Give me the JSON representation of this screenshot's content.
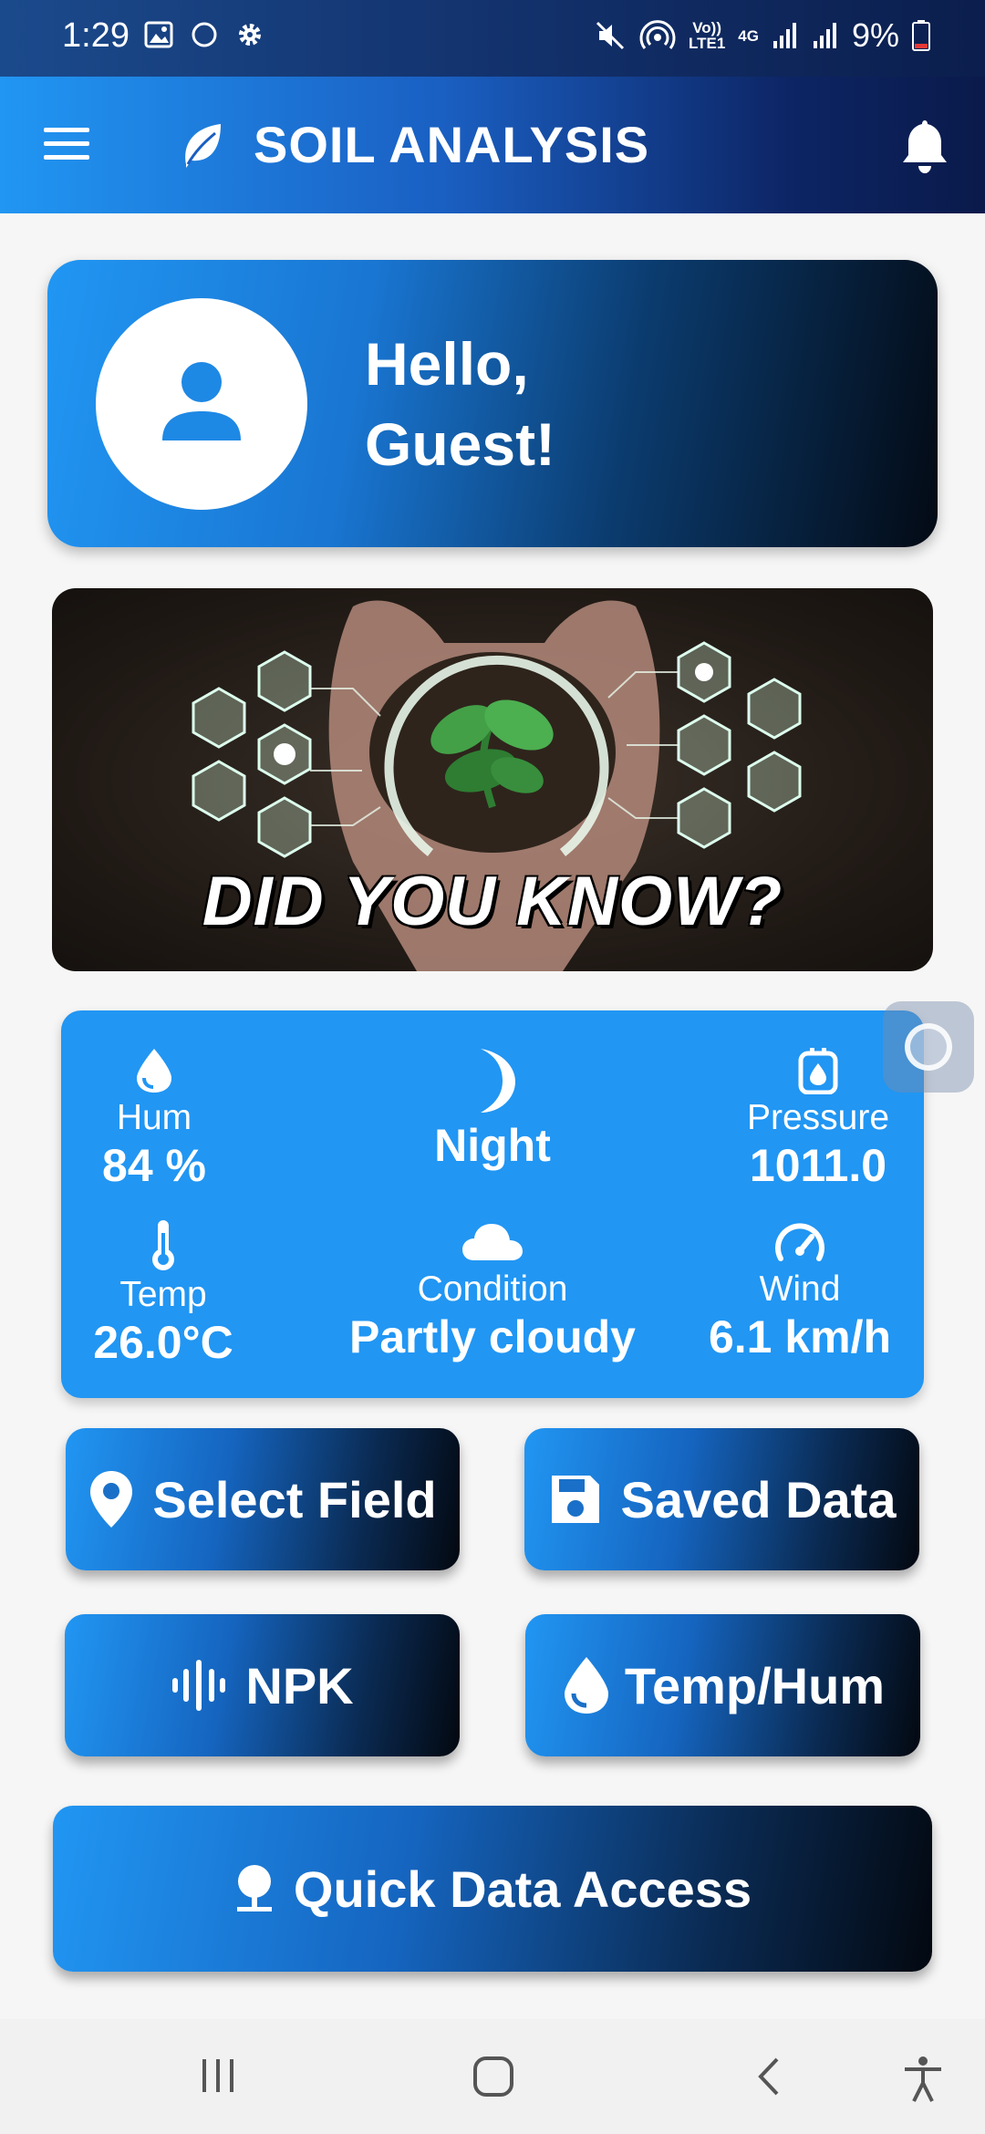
{
  "status_bar": {
    "time": "1:29",
    "network_top": "Vo))",
    "network_bottom": "LTE1",
    "net_gen": "4G",
    "battery": "9%"
  },
  "app_bar": {
    "title": "SOIL ANALYSIS",
    "menu_icon": "hamburger-menu-icon",
    "logo_icon": "leaf-icon",
    "notification_icon": "bell-icon"
  },
  "greeting": {
    "line1": "Hello,",
    "line2": "Guest!"
  },
  "banner": {
    "title": "DID YOU KNOW?"
  },
  "weather": {
    "humidity_label": "Hum",
    "humidity_value": "84 %",
    "time_of_day": "Night",
    "pressure_label": "Pressure",
    "pressure_value": "1011.0",
    "temp_label": "Temp",
    "temp_value": "26.0°C",
    "condition_label": "Condition",
    "condition_value": "Partly cloudy",
    "wind_label": "Wind",
    "wind_value": "6.1 km/h"
  },
  "actions": {
    "select_field": "Select Field",
    "saved_data": "Saved Data",
    "npk": "NPK",
    "temp_hum": "Temp/Hum",
    "quick_access": "Quick Data Access"
  },
  "colors": {
    "primary": "#2196f3",
    "dark": "#030a14"
  }
}
